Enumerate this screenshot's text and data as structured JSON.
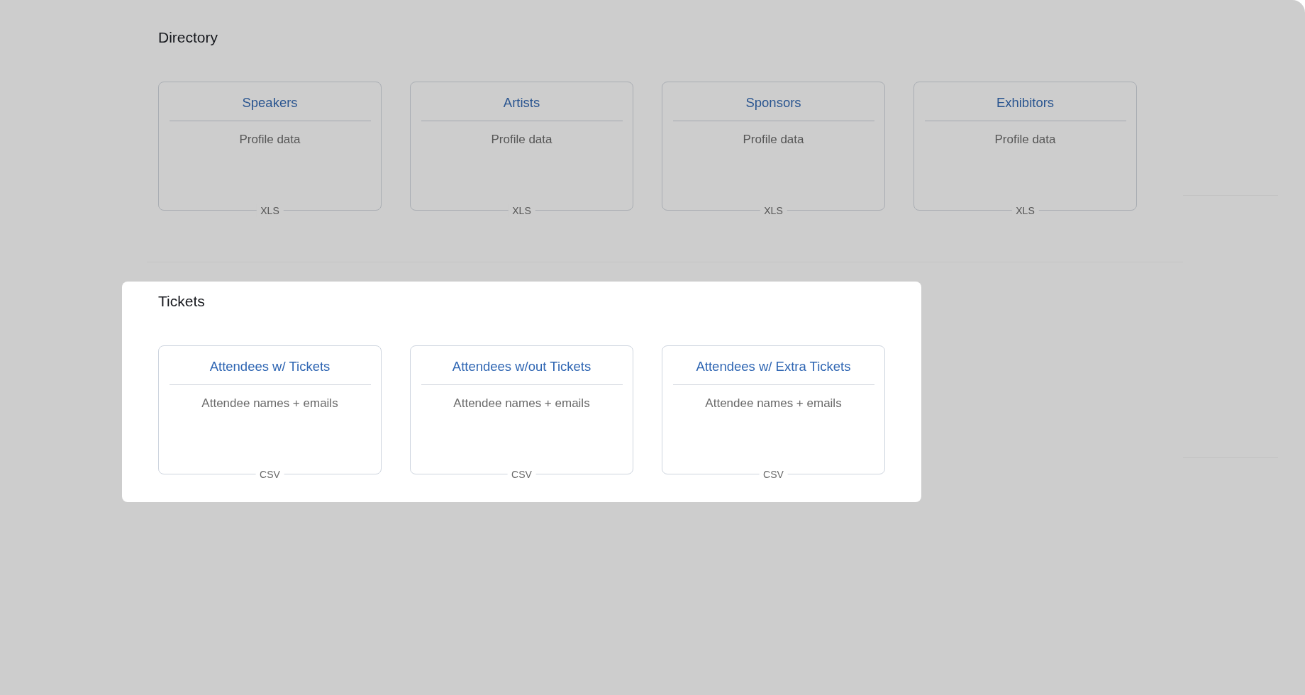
{
  "sections": [
    {
      "title": "Directory",
      "highlighted": false,
      "cards": [
        {
          "title": "Speakers",
          "description": "Profile data",
          "format": "XLS"
        },
        {
          "title": "Artists",
          "description": "Profile data",
          "format": "XLS"
        },
        {
          "title": "Sponsors",
          "description": "Profile data",
          "format": "XLS"
        },
        {
          "title": "Exhibitors",
          "description": "Profile data",
          "format": "XLS"
        }
      ]
    },
    {
      "title": "Tickets",
      "highlighted": true,
      "cards": [
        {
          "title": "Attendees w/ Tickets",
          "description": "Attendee names + emails",
          "format": "CSV"
        },
        {
          "title": "Attendees w/out Tickets",
          "description": "Attendee names + emails",
          "format": "CSV"
        },
        {
          "title": "Attendees w/ Extra Tickets",
          "description": "Attendee names + emails",
          "format": "CSV"
        }
      ]
    }
  ]
}
